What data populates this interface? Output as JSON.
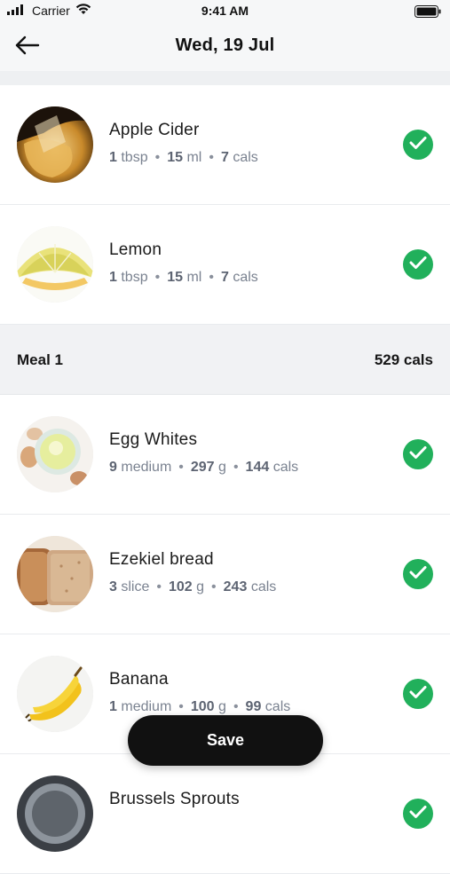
{
  "status_bar": {
    "carrier": "Carrier",
    "time": "9:41 AM"
  },
  "header": {
    "title": "Wed, 19 Jul"
  },
  "colors": {
    "check_green": "#21b05b",
    "meta_gray": "#7a8290",
    "save_button": "#111111"
  },
  "items_before": [
    {
      "name": "Apple Cider",
      "qty": "1",
      "unit": "tbsp",
      "weight_num": "15",
      "weight_unit": "ml",
      "cals_num": "7",
      "cals_unit": "cals",
      "checked": true,
      "icon": "apple-cider-photo"
    },
    {
      "name": "Lemon",
      "qty": "1",
      "unit": "tbsp",
      "weight_num": "15",
      "weight_unit": "ml",
      "cals_num": "7",
      "cals_unit": "cals",
      "checked": true,
      "icon": "lemon-photo"
    }
  ],
  "meal": {
    "title": "Meal 1",
    "cals": "529 cals"
  },
  "items_meal": [
    {
      "name": "Egg Whites",
      "qty": "9",
      "unit": "medium",
      "weight_num": "297",
      "weight_unit": "g",
      "cals_num": "144",
      "cals_unit": "cals",
      "checked": true,
      "icon": "egg-whites-photo"
    },
    {
      "name": "Ezekiel bread",
      "qty": "3",
      "unit": "slice",
      "weight_num": "102",
      "weight_unit": "g",
      "cals_num": "243",
      "cals_unit": "cals",
      "checked": true,
      "icon": "bread-photo"
    },
    {
      "name": "Banana",
      "qty": "1",
      "unit": "medium",
      "weight_num": "100",
      "weight_unit": "g",
      "cals_num": "99",
      "cals_unit": "cals",
      "checked": true,
      "icon": "banana-photo"
    },
    {
      "name": "Brussels Sprouts",
      "qty": "",
      "unit": "",
      "weight_num": "",
      "weight_unit": "",
      "cals_num": "",
      "cals_unit": "",
      "checked": true,
      "icon": "brussels-sprouts-photo"
    }
  ],
  "save_button": {
    "label": "Save"
  }
}
